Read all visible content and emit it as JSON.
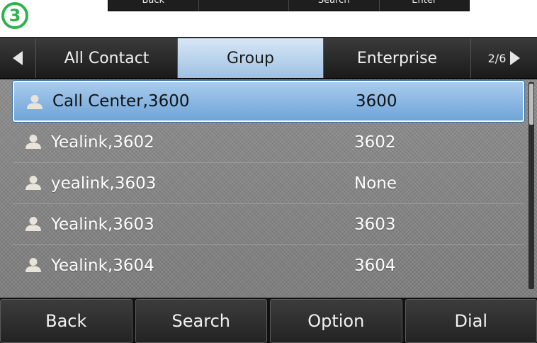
{
  "step_badge": "3",
  "top_softkeys": [
    "Back",
    "",
    "Search",
    "Enter"
  ],
  "tabs": {
    "items": [
      "All Contact",
      "Group",
      "Enterprise"
    ],
    "active": "Group",
    "page_indicator": "2/6"
  },
  "contacts": [
    {
      "name": "Call Center,3600",
      "number": "3600",
      "selected": true
    },
    {
      "name": "Yealink,3602",
      "number": "3602"
    },
    {
      "name": "yealink,3603",
      "number": "None"
    },
    {
      "name": "Yealink,3603",
      "number": "3603"
    },
    {
      "name": "Yealink,3604",
      "number": "3604"
    }
  ],
  "softkeys": [
    "Back",
    "Search",
    "Option",
    "Dial"
  ],
  "icons": {
    "contact": "person-icon",
    "tab_prev": "triangle-left-icon",
    "tab_next": "triangle-right-icon"
  },
  "colors": {
    "selection": "#8fb8e2",
    "badge": "#2eb34f",
    "background": "#858585"
  }
}
